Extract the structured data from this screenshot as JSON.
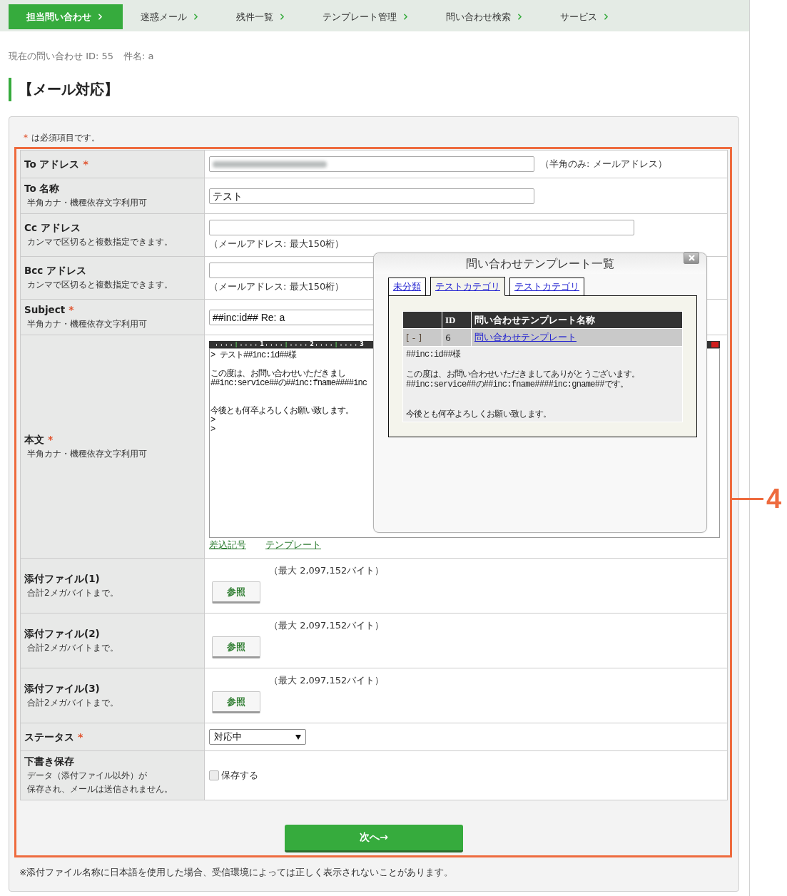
{
  "nav": {
    "items": [
      {
        "label": "担当問い合わせ",
        "selected": true
      },
      {
        "label": "迷惑メール",
        "selected": false
      },
      {
        "label": "残件一覧",
        "selected": false
      },
      {
        "label": "テンプレート管理",
        "selected": false
      },
      {
        "label": "問い合わせ検索",
        "selected": false
      },
      {
        "label": "サービス",
        "selected": false
      }
    ]
  },
  "context": {
    "inquiry": "現在の問い合わせ ID: 55",
    "subject": "件名: a"
  },
  "heading": "【メール対応】",
  "form": {
    "required_note": {
      "mark": "*",
      "text": "は必須項目です。"
    },
    "rows": [
      {
        "kind": "field",
        "label": "To アドレス",
        "required_mark": "*",
        "value_blurred": true,
        "hint": "（半角のみ: メールアドレス）"
      },
      {
        "kind": "field",
        "label": "To 名称",
        "notes": [
          "半角カナ・機種依存文字利用可"
        ],
        "value": "テスト"
      },
      {
        "kind": "field-wide",
        "label": "Cc アドレス",
        "notes": [
          "カンマで区切ると複数指定できます。"
        ],
        "hint": "（メールアドレス: 最大150桁）"
      },
      {
        "kind": "field-wide",
        "label": "Bcc アドレス",
        "notes": [
          "カンマで区切ると複数指定できます。"
        ],
        "hint": "（メールアドレス: 最大150桁）"
      },
      {
        "kind": "field",
        "label": "Subject",
        "required_mark": "*",
        "notes": [
          "半角カナ・機種依存文字利用可"
        ],
        "value": "##inc:id## Re: a"
      },
      {
        "kind": "editor",
        "label": "本文",
        "required_mark": "*",
        "notes": [
          "半角カナ・機種依存文字利用可"
        ],
        "ruler_labels": [
          "1",
          "2",
          "3"
        ],
        "lines": [
          {
            "kind": "text",
            "text": "> テスト##inc:id##様"
          },
          {
            "kind": "blank"
          },
          {
            "kind": "text",
            "text": "この度は、お問い合わせいただきまし"
          },
          {
            "kind": "text",
            "text": "##inc:service##の##inc:fname####inc"
          },
          {
            "kind": "blank"
          },
          {
            "kind": "blank"
          },
          {
            "kind": "text",
            "text": "今後とも何卒よろしくお願い致します。"
          },
          {
            "kind": "text",
            "text": ">"
          },
          {
            "kind": "text",
            "text": ">"
          }
        ],
        "links": [
          "差込記号",
          "テンプレート"
        ]
      },
      {
        "kind": "file",
        "label": "添付ファイル(1)",
        "notes": [
          "合計2メガバイトまで。"
        ],
        "limit": "（最大 2,097,152バイト）",
        "button": "参照"
      },
      {
        "kind": "file",
        "label": "添付ファイル(2)",
        "notes": [
          "合計2メガバイトまで。"
        ],
        "limit": "（最大 2,097,152バイト）",
        "button": "参照"
      },
      {
        "kind": "file",
        "label": "添付ファイル(3)",
        "notes": [
          "合計2メガバイトまで。"
        ],
        "limit": "（最大 2,097,152バイト）",
        "button": "参照"
      },
      {
        "kind": "select",
        "label": "ステータス",
        "required_mark": "*",
        "value": "対応中"
      },
      {
        "kind": "checkbox",
        "label": "下書き保存",
        "notes": [
          "データ（添付ファイル以外）が",
          "保存され、メールは送信されません。"
        ],
        "option": "保存する",
        "checked": false
      }
    ],
    "submit": "次へ→",
    "footnote": "※添付ファイル名称に日本語を使用した場合、受信環境によっては正しく表示されないことがあります。"
  },
  "popup": {
    "title": "問い合わせテンプレート一覧",
    "tabs": [
      {
        "label": "未分類",
        "selected": false
      },
      {
        "label": "テストカテゴリ",
        "selected": true
      },
      {
        "label": "テストカテゴリ",
        "selected": false
      }
    ],
    "table": {
      "columns": [
        "ID",
        "問い合わせテンプレート名称"
      ],
      "rows": [
        {
          "toggle": "[ - ]",
          "id": "6",
          "name": "問い合わせテンプレート",
          "expanded": true,
          "preview": [
            {
              "kind": "text",
              "text": "##inc:id##様"
            },
            {
              "kind": "blank"
            },
            {
              "kind": "text",
              "text": "この度は、お問い合わせいただきましてありがとうございます。"
            },
            {
              "kind": "text",
              "text": "##inc:service##の##inc:fname####inc:gname##です。"
            },
            {
              "kind": "blank"
            },
            {
              "kind": "blank"
            },
            {
              "kind": "text",
              "text": "今後とも何卒よろしくお願い致します。"
            }
          ]
        }
      ]
    }
  },
  "annotation": {
    "label": "4"
  }
}
